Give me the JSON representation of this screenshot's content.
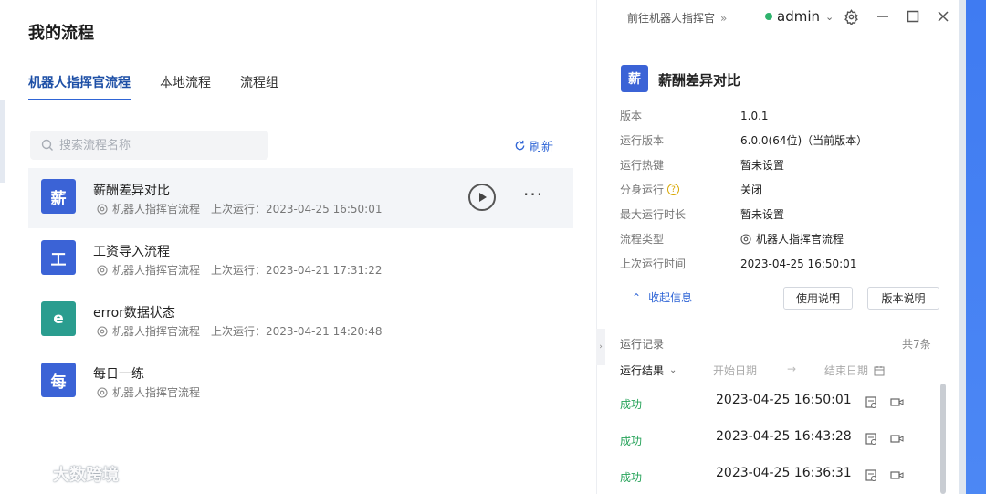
{
  "header": {
    "title": "我的流程",
    "goto_label": "前往机器人指挥官",
    "goto_chevron": "»",
    "username": "admin"
  },
  "tabs": [
    {
      "label": "机器人指挥官流程",
      "active": true
    },
    {
      "label": "本地流程",
      "active": false
    },
    {
      "label": "流程组",
      "active": false
    }
  ],
  "search": {
    "placeholder": "搜索流程名称"
  },
  "refresh_label": "刷新",
  "flows": [
    {
      "badge": "薪",
      "badge_color": "#3b63d6",
      "name": "薪酬差异对比",
      "source": "机器人指挥官流程",
      "last_run": "上次运行：2023-04-25 16:50:01"
    },
    {
      "badge": "工",
      "badge_color": "#3b63d6",
      "name": "工资导入流程",
      "source": "机器人指挥官流程",
      "last_run": "上次运行：2023-04-21 17:31:22"
    },
    {
      "badge": "e",
      "badge_color": "#2a9d8f",
      "name": "error数据状态",
      "source": "机器人指挥官流程",
      "last_run": "上次运行：2023-04-21 14:20:48"
    },
    {
      "badge": "每",
      "badge_color": "#3b63d6",
      "name": "每日一练",
      "source": "机器人指挥官流程",
      "last_run": ""
    }
  ],
  "more_label": "···",
  "detail": {
    "badge": "薪",
    "title": "薪酬差异对比",
    "rows": [
      {
        "key": "版本",
        "value": "1.0.1"
      },
      {
        "key": "运行版本",
        "value": "6.0.0(64位)（当前版本）"
      },
      {
        "key": "运行热键",
        "value": "暂未设置"
      },
      {
        "key": "分身运行",
        "value": "关闭",
        "help": "?"
      },
      {
        "key": "最大运行时长",
        "value": "暂未设置"
      },
      {
        "key": "流程类型",
        "value": "机器人指挥官流程"
      },
      {
        "key": "上次运行时间",
        "value": "2023-04-25 16:50:01"
      }
    ],
    "collapse_label": "收起信息",
    "usage_btn": "使用说明",
    "version_btn": "版本说明"
  },
  "records": {
    "title": "运行记录",
    "count": "共7条",
    "filter_result": "运行结果",
    "start_date": "开始日期",
    "arrow": "→",
    "end_date": "结束日期",
    "items": [
      {
        "status": "成功",
        "time": "2023-04-25 16:50:01"
      },
      {
        "status": "成功",
        "time": "2023-04-25 16:43:28"
      },
      {
        "status": "成功",
        "time": "2023-04-25 16:36:31"
      }
    ]
  },
  "watermark": "大数跨境",
  "colors": {
    "accent": "#2f65d6",
    "success": "#27a35a",
    "status_online": "#2fb36d"
  }
}
